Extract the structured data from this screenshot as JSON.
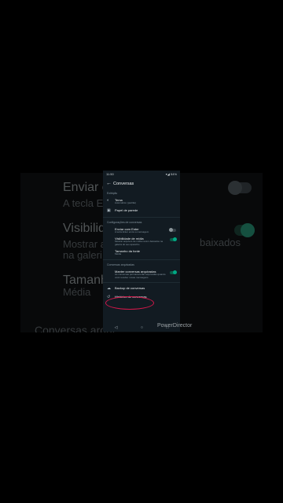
{
  "background": {
    "item1_title": "Enviar co",
    "item1_sub": "A tecla E",
    "item2_title": "Visibilid",
    "item2_sub1": "Mostrar a",
    "item2_sub1_right": "baixados",
    "item2_sub2": "na galeri",
    "item3_title": "Tamanh",
    "item3_sub": "Média",
    "item4": "Conversas arqui"
  },
  "status": {
    "time": "11:50",
    "right": "▾◢ 54%"
  },
  "appbar": {
    "back": "←",
    "title": "Conversas"
  },
  "sections": {
    "display": "Exibição",
    "chat_settings": "Configurações de conversas",
    "archived": "Conversas arquivadas"
  },
  "items": {
    "tema": {
      "title": "Tema",
      "sub": "Automático (padrão)"
    },
    "papel": {
      "title": "Papel de parede"
    },
    "enter": {
      "title": "Enviar com Enter",
      "sub": "A tecla Enter envia a mensagem"
    },
    "midia": {
      "title": "Visibilidade de mídia",
      "sub": "Mostrar arquivos de mídia recém-baixados na galeria do seu aparelho"
    },
    "fonte": {
      "title": "Tamanho da fonte",
      "sub": "Média"
    },
    "arquivadas": {
      "title": "Manter conversas arquivadas",
      "sub": "As conversas permanecerão arquivadas quando você receber novas mensagens"
    },
    "backup": {
      "title": "Backup de conversas"
    },
    "historico": {
      "title": "Histórico de conversas"
    }
  },
  "nav": {
    "back": "◁",
    "home": "○",
    "recents": "□"
  },
  "watermark": "PowerDirector",
  "colors": {
    "accent": "#00a884",
    "highlight": "#d4174a",
    "background": "#121b22"
  }
}
